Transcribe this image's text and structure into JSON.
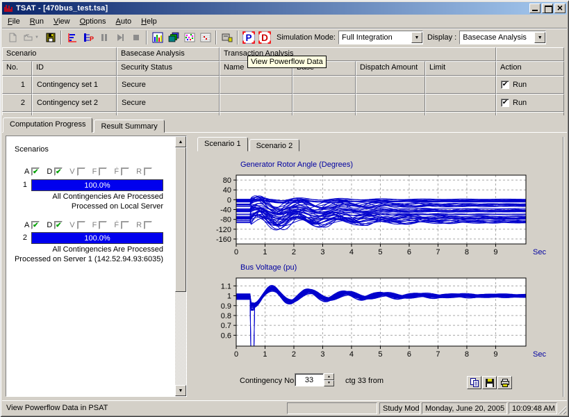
{
  "window": {
    "title": "TSAT - [470bus_test.tsa]"
  },
  "menu": {
    "items": [
      "File",
      "Run",
      "View",
      "Options",
      "Auto",
      "Help"
    ]
  },
  "toolbar": {
    "icons": [
      "new-file-icon",
      "open-file-icon",
      "save-icon",
      "run-plot-icon",
      "run-transfer-icon",
      "pause-icon",
      "step-icon",
      "stop-icon",
      "bar-chart-icon",
      "multi-plot-icon",
      "scatter-plot-icon",
      "table-grid-icon",
      "compute-server-icon",
      "psat-icon",
      "dsat-icon"
    ],
    "simulation_mode_label": "Simulation Mode:",
    "simulation_mode_value": "Full Integration",
    "display_label": "Display :",
    "display_value": "Basecase Analysis",
    "tooltip": "View Powerflow Data"
  },
  "table": {
    "group_headers": [
      "Scenario",
      "Basecase Analysis",
      "Transaction Analysis",
      ""
    ],
    "columns": [
      "No.",
      "ID",
      "Security Status",
      "Name",
      "Base",
      "Dispatch Amount",
      "Limit",
      "Action"
    ],
    "rows": [
      {
        "no": "1",
        "id": "Contingency set 1",
        "security_status": "Secure",
        "name": "",
        "base": "",
        "dispatch_amount": "",
        "limit": "",
        "action": "Run",
        "action_checked": true
      },
      {
        "no": "2",
        "id": "Contingency set 2",
        "security_status": "Secure",
        "name": "",
        "base": "",
        "dispatch_amount": "",
        "limit": "",
        "action": "Run",
        "action_checked": true
      }
    ]
  },
  "main_tabs": [
    {
      "label": "Computation Progress",
      "active": true
    },
    {
      "label": "Result Summary",
      "active": false
    }
  ],
  "progress_panel": {
    "title": "Scenarios",
    "status_flags": [
      {
        "label": "A",
        "checked": true
      },
      {
        "label": "D",
        "checked": true
      },
      {
        "label": "V",
        "checked": false
      },
      {
        "label": "F",
        "checked": false
      },
      {
        "label": "Ḟ",
        "checked": false
      },
      {
        "label": "R",
        "checked": false
      }
    ],
    "scenarios": [
      {
        "no": "1",
        "progress": "100.0%",
        "line1": "All Contingencies Are Processed",
        "line2": "Processed on Local Server"
      },
      {
        "no": "2",
        "progress": "100.0%",
        "line1": "All Contingencies Are Processed",
        "line2": "Processed on Server 1 (142.52.94.93:6035)"
      }
    ]
  },
  "scenario_tabs": [
    {
      "label": "Scenario 1",
      "active": true
    },
    {
      "label": "Scenario 2",
      "active": false
    }
  ],
  "contingency": {
    "label": "Contingency No.",
    "value": "33",
    "suffix": "ctg 33 from"
  },
  "chart_buttons": {
    "icons": [
      "copy-icon",
      "save-icon",
      "print-icon"
    ]
  },
  "status_bar": {
    "message": "View Powerflow Data in PSAT",
    "mode": "Study Mode",
    "date": "Monday, June 20, 2005",
    "time": "10:09:48 AM"
  },
  "colors": {
    "chrome": "#D4D0C8",
    "titlebar_dark": "#0A246A",
    "titlebar_light": "#A6CAF0",
    "progress_blue": "#0000EE",
    "chart_line_blue": "#0000CC",
    "chart_title_blue": "#0000A0",
    "tooltip_bg": "#FFFFE1",
    "check_green": "#00A000"
  },
  "chart_data": [
    {
      "type": "line",
      "title": "Generator Rotor Angle (Degrees)",
      "xlabel": "Sec",
      "ylabel": "",
      "xlim": [
        0,
        10.05
      ],
      "ylim": [
        -180,
        100
      ],
      "xticks": [
        0,
        1,
        2,
        3,
        4,
        5,
        6,
        7,
        8,
        9
      ],
      "yticks": [
        80,
        40,
        0,
        -40,
        -80,
        -120,
        -160
      ],
      "grid": true,
      "line_color": "#0000CC",
      "series_model": {
        "kind": "rotor_angle",
        "count": 42,
        "seed": 7,
        "t_end": 10.05,
        "t_step": 0.04,
        "fault_time": 0.5,
        "offset_range": [
          -95,
          5
        ],
        "amplitude_range": [
          8,
          45
        ],
        "freq_range": [
          0.62,
          0.8
        ],
        "damping_range": [
          0.26,
          0.4
        ],
        "envelope": {
          "offset": -85,
          "amplitude": 48,
          "freq": 0.7,
          "phase": -0.35,
          "damping": 0.22
        }
      },
      "description": "Dense bundle of ~40 damped oscillating rotor-angle traces between +15 and -130 degrees, settling toward -5 to -90 degrees by t=10s"
    },
    {
      "type": "line",
      "title": "Bus Voltage (pu)",
      "xlabel": "Sec",
      "ylabel": "",
      "xlim": [
        0,
        10.05
      ],
      "ylim": [
        0.49,
        1.18
      ],
      "xticks": [
        0,
        1,
        2,
        3,
        4,
        5,
        6,
        7,
        8,
        9
      ],
      "yticks": [
        1.1,
        1,
        0.9,
        0.8,
        0.7,
        0.6
      ],
      "grid": true,
      "line_color": "#0000CC",
      "series_model": {
        "kind": "bus_voltage",
        "count": 32,
        "seed": 11,
        "t_end": 10.05,
        "t_step": 0.04,
        "fault_time": 0.5,
        "clear_time": 0.62,
        "pre_range": [
          0.96,
          1.02
        ],
        "dip_range": [
          0.85,
          0.93
        ],
        "deep_dip_count": 3,
        "deep_dip_range": [
          0.15,
          0.35
        ],
        "overshoot_amp": [
          0.075,
          0.125
        ],
        "settle_range": [
          0.985,
          1.015
        ],
        "freq_range": [
          0.74,
          0.82
        ],
        "phase": -1.5,
        "damping_range": [
          0.3,
          0.42
        ]
      },
      "description": "~30 bus-voltage traces flat near 1.0 pu, fault dip at t≈0.5s (a few collapsing below 0.5 pu), recovery overshoot to ≈1.1 pu near t≈1.4s, damped ringing settling to ≈1.0 pu"
    }
  ]
}
